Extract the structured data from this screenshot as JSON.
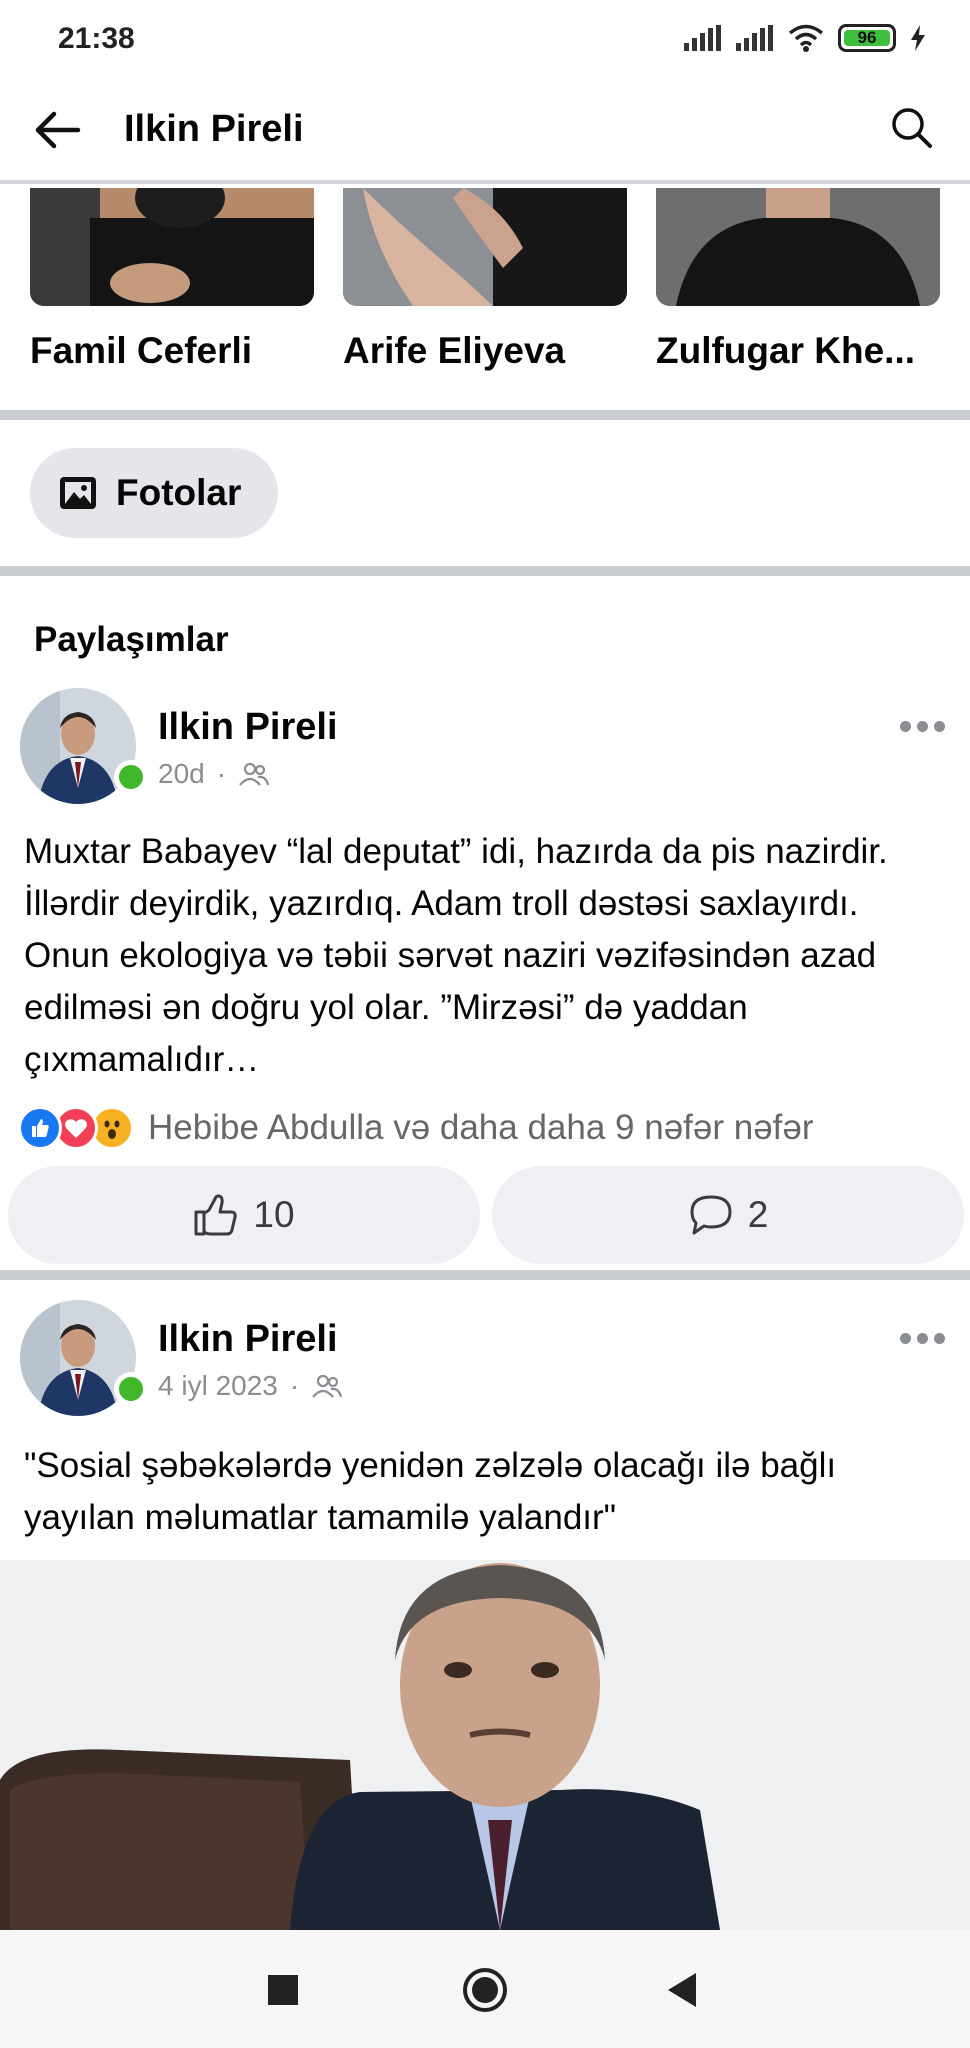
{
  "status_bar": {
    "time": "21:38",
    "battery": "96"
  },
  "header": {
    "title": "Ilkin Pireli"
  },
  "friends": [
    {
      "name": "Famil Ceferli"
    },
    {
      "name": "Arife Eliyeva"
    },
    {
      "name": "Zulfugar Khe..."
    }
  ],
  "photos_button": {
    "label": "Fotolar"
  },
  "posts_section": {
    "title": "Paylaşımlar"
  },
  "posts": [
    {
      "author": "Ilkin Pireli",
      "time": "20d",
      "separator": "·",
      "text": "Muxtar Babayev “lal deputat” idi, hazırda da pis nazirdir. İllərdir deyirdik, yazırdıq. Adam troll dəstəsi saxlayırdı. Onun ekologiya və təbii sərvət naziri vəzifəsindən azad edilməsi ən doğru yol olar. ”Mirzəsi” də yaddan çıxmamalıdır…",
      "reactions_text": "Hebibe Abdulla və daha daha 9 nəfər nəfər",
      "likes": "10",
      "comments": "2"
    },
    {
      "author": "Ilkin Pireli",
      "time": "4 iyl 2023",
      "separator": "·",
      "text": "\"Sosial şəbəkələrdə yenidən zəlzələ olacağı ilə bağlı yayılan məlumatlar tamamilə yalandır\""
    }
  ],
  "colors": {
    "online": "#42b72a",
    "like_blue": "#1877f2",
    "love_red": "#f33e58",
    "wow_yellow": "#f7b125"
  }
}
